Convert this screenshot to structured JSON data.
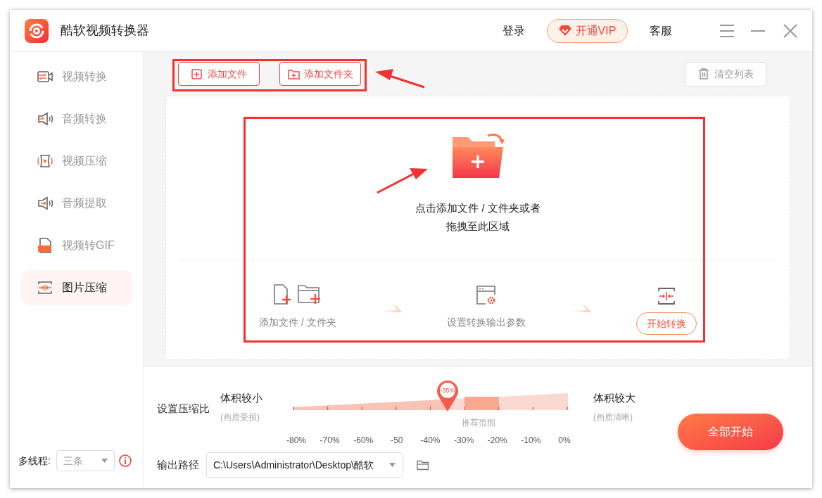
{
  "window": {
    "title": "酷软视频转换器"
  },
  "header": {
    "login": "登录",
    "vip": "开通VIP",
    "service": "客服"
  },
  "toolbar": {
    "add_file": "添加文件",
    "add_folder": "添加文件夹",
    "clear": "清空列表"
  },
  "sidebar": {
    "items": [
      {
        "kind": "video-convert",
        "label": "视频转换",
        "selected": false
      },
      {
        "kind": "audio-convert",
        "label": "音频转换",
        "selected": false
      },
      {
        "kind": "video-compress",
        "label": "视频压缩",
        "selected": false
      },
      {
        "kind": "audio-extract",
        "label": "音频提取",
        "selected": false
      },
      {
        "kind": "gif",
        "label": "视频转GIF",
        "selected": false
      },
      {
        "kind": "image-compress",
        "label": "图片压缩",
        "selected": true
      }
    ],
    "threads": {
      "label": "多线程:",
      "value": "三条"
    }
  },
  "drop_zone": {
    "prompt_lines": [
      "点击添加文件 / 文件夹或者",
      "拖拽至此区域"
    ],
    "steps": [
      {
        "kind": "add",
        "label": "添加文件 / 文件夹"
      },
      {
        "kind": "settings",
        "label": "设置转换输出参数"
      },
      {
        "kind": "start",
        "label": "开始转换"
      }
    ]
  },
  "compression": {
    "label": "设置压缩比",
    "min_label": "体积较小",
    "min_note": "(画质受损)",
    "max_label": "体积较大",
    "max_note": "(画质清晰)",
    "marker": "-35%",
    "level": 0.5625,
    "range_label": "推荐范围",
    "ticks": [
      "-80%",
      "-70%",
      "-60%",
      "-50",
      "-40%",
      "-30%",
      "-20%",
      "-10%",
      "0%"
    ]
  },
  "output": {
    "label": "输出路径",
    "path": "C:\\Users\\Administrator\\Desktop\\酷软"
  },
  "start_all": "全部开始"
}
